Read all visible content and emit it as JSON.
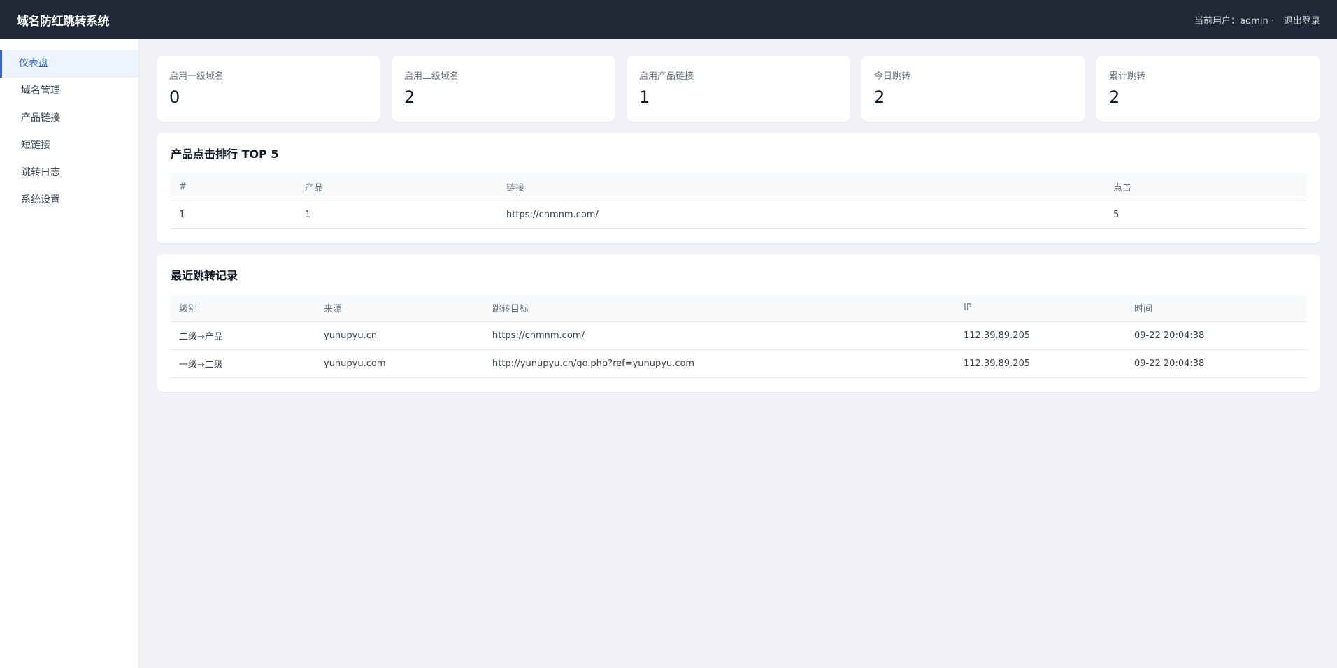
{
  "app": {
    "title": "域名防红跳转系统"
  },
  "header": {
    "user_text": "当前用户：admin ·",
    "logout_label": "退出登录"
  },
  "sidebar": {
    "items": [
      {
        "label": "仪表盘"
      },
      {
        "label": "域名管理"
      },
      {
        "label": "产品链接"
      },
      {
        "label": "短链接"
      },
      {
        "label": "跳转日志"
      },
      {
        "label": "系统设置"
      }
    ]
  },
  "stats": [
    {
      "label": "启用一级域名",
      "value": "0"
    },
    {
      "label": "启用二级域名",
      "value": "2"
    },
    {
      "label": "启用产品链接",
      "value": "1"
    },
    {
      "label": "今日跳转",
      "value": "2"
    },
    {
      "label": "累计跳转",
      "value": "2"
    }
  ],
  "top_products": {
    "title": "产品点击排行 TOP 5",
    "headers": [
      "#",
      "产品",
      "链接",
      "点击"
    ],
    "rows": [
      [
        "1",
        "1",
        "https://cnmnm.com/",
        "5"
      ]
    ]
  },
  "recent_redirects": {
    "title": "最近跳转记录",
    "headers": [
      "级别",
      "来源",
      "跳转目标",
      "IP",
      "时间"
    ],
    "rows": [
      [
        "二级→产品",
        "yunupyu.cn",
        "https://cnmnm.com/",
        "112.39.89.205",
        "09-22 20:04:38"
      ],
      [
        "一级→二级",
        "yunupyu.com",
        "http://yunupyu.cn/go.php?ref=yunupyu.com",
        "112.39.89.205",
        "09-22 20:04:38"
      ]
    ]
  },
  "colors": {
    "topbar": "#1f2937",
    "accent": "#2563eb",
    "background": "#f0f2f5"
  }
}
